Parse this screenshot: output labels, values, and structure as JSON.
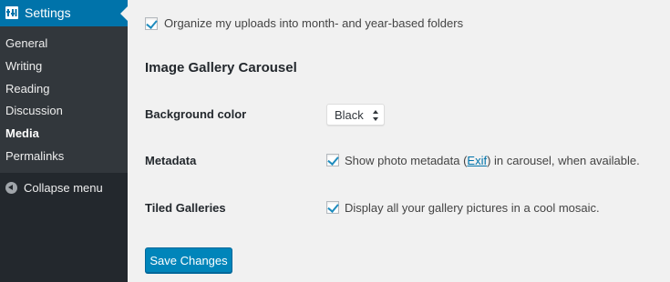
{
  "sidebar": {
    "settings_label": "Settings",
    "items": [
      {
        "label": "General"
      },
      {
        "label": "Writing"
      },
      {
        "label": "Reading"
      },
      {
        "label": "Discussion"
      },
      {
        "label": "Media",
        "current": true
      },
      {
        "label": "Permalinks"
      }
    ],
    "collapse_label": "Collapse menu"
  },
  "uploads": {
    "organize_label": "Organize my uploads into month- and year-based folders",
    "organize_checked": true
  },
  "carousel": {
    "heading": "Image Gallery Carousel",
    "background_color_label": "Background color",
    "background_color_value": "Black",
    "metadata_label": "Metadata",
    "metadata_text_before": "Show photo metadata (",
    "metadata_link": "Exif",
    "metadata_text_after": ") in carousel, when available.",
    "metadata_checked": true,
    "tiled_label": "Tiled Galleries",
    "tiled_text": "Display all your gallery pictures in a cool mosaic.",
    "tiled_checked": true
  },
  "save_button": "Save Changes",
  "colors": {
    "sidebar_bg": "#23282d",
    "submenu_bg": "#32373c",
    "accent": "#0073aa",
    "button": "#0085ba",
    "page_bg": "#f1f1f1"
  }
}
